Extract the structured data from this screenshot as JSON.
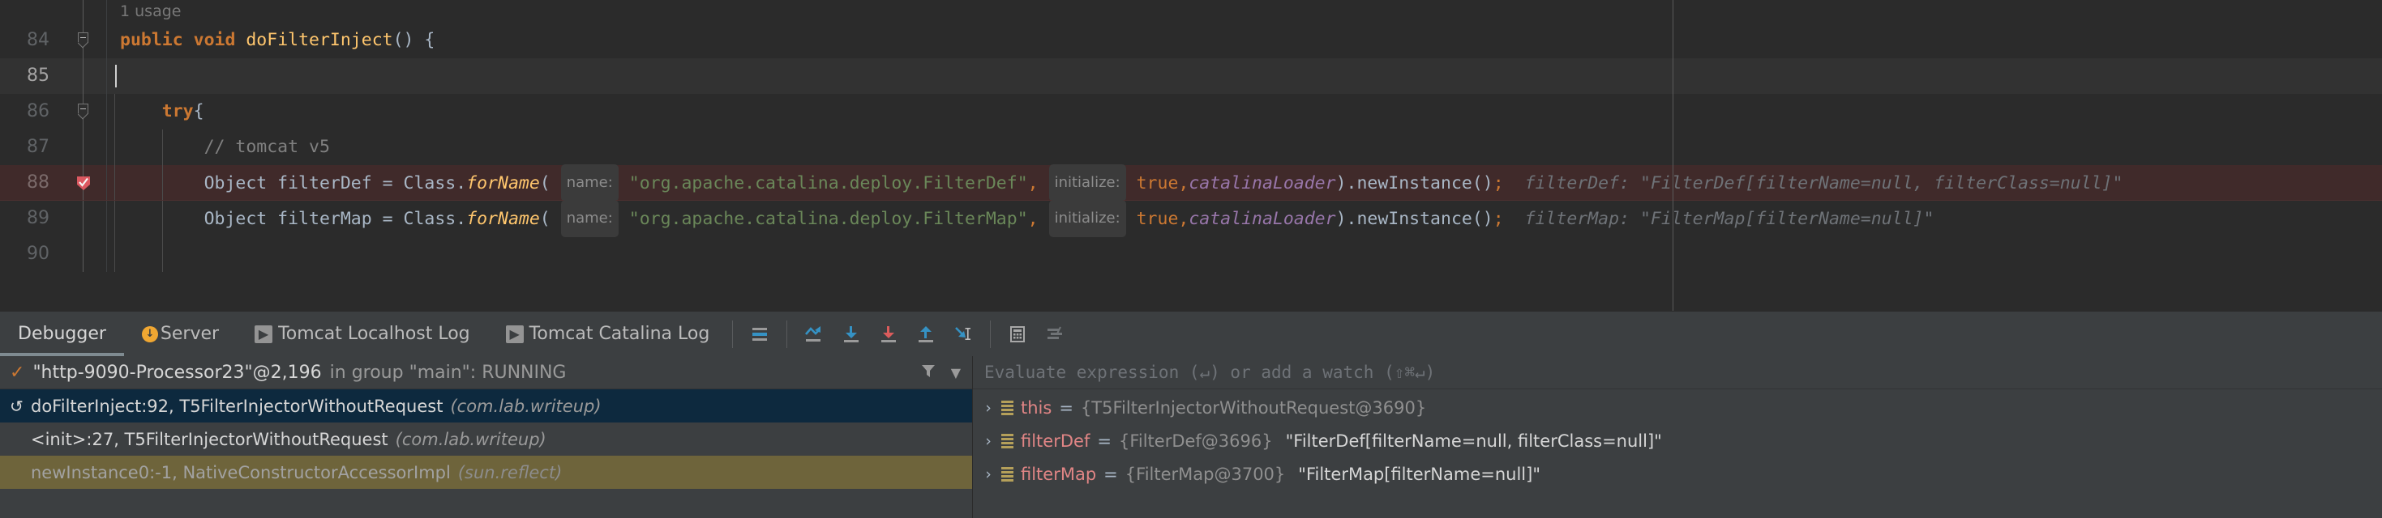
{
  "editor": {
    "usage_hint": "1 usage",
    "margin_line_x": 2063,
    "lines": [
      {
        "num": "84",
        "fold": true,
        "indent": [],
        "html": "<span class=\"kwb\">public</span> <span class=\"kwb\">void</span> <span class=\"mtd\">doFilterInject</span><span class=\"pl\">() {</span>",
        "text": "public void doFilterInject() {"
      },
      {
        "num": "85",
        "fold": false,
        "caret": true,
        "indent": [],
        "html": "",
        "text": ""
      },
      {
        "num": "86",
        "fold": true,
        "indent": [
          141
        ],
        "html": "&nbsp;&nbsp;&nbsp;&nbsp;<span class=\"kwb\">try</span><span class=\"pl\">{</span>",
        "text": "    try{"
      },
      {
        "num": "87",
        "fold": false,
        "indent": [
          141,
          200
        ],
        "html": "&nbsp;&nbsp;&nbsp;&nbsp;&nbsp;&nbsp;&nbsp;&nbsp;<span class=\"cmt\">// tomcat v5</span>",
        "text": "        // tomcat v5"
      },
      {
        "num": "88",
        "breakpoint": true,
        "indent": [
          141,
          200
        ],
        "html": "&nbsp;&nbsp;&nbsp;&nbsp;&nbsp;&nbsp;&nbsp;&nbsp;<span class=\"pl\">Object filterDef = Class.</span><span class=\"mtdi\">forName</span><span class=\"pl\">(</span> <span class=\"hintchip\">name:</span> <span class=\"str\">\"org.apache.catalina.deploy.FilterDef\"</span><span class=\"sem\">,</span> <span class=\"hintchip\">initialize:</span> <span class=\"kw\">true</span><span class=\"sem\">,</span><span class=\"fld\">catalinaLoader</span><span class=\"pl\">).newInstance()</span><span class=\"sem\">;</span>&nbsp;&nbsp;<span class=\"inlay\">filterDef: \"FilterDef[filterName=null, filterClass=null]\"</span>",
        "text": "        Object filterDef = Class.forName( name: \"org.apache.catalina.deploy.FilterDef\", initialize: true,catalinaLoader).newInstance();   filterDef: \"FilterDef[filterName=null, filterClass=null]\""
      },
      {
        "num": "89",
        "indent": [
          141,
          200
        ],
        "html": "&nbsp;&nbsp;&nbsp;&nbsp;&nbsp;&nbsp;&nbsp;&nbsp;<span class=\"pl\">Object filterMap = Class.</span><span class=\"mtdi\">forName</span><span class=\"pl\">(</span> <span class=\"hintchip\">name:</span> <span class=\"str\">\"org.apache.catalina.deploy.FilterMap\"</span><span class=\"sem\">,</span> <span class=\"hintchip\">initialize:</span> <span class=\"kw\">true</span><span class=\"sem\">,</span><span class=\"fld\">catalinaLoader</span><span class=\"pl\">).newInstance()</span><span class=\"sem\">;</span>&nbsp;&nbsp;<span class=\"inlay\">filterMap: \"FilterMap[filterName=null]\"</span>",
        "text": "        Object filterMap = Class.forName( name: \"org.apache.catalina.deploy.FilterMap\", initialize: true,catalinaLoader).newInstance();   filterMap: \"FilterMap[filterName=null]\""
      },
      {
        "num": "90",
        "indent": [
          141,
          200
        ],
        "html": "",
        "text": ""
      }
    ]
  },
  "bottom": {
    "tabs": [
      {
        "label": "Debugger",
        "icon": null,
        "active": true
      },
      {
        "label": "Server",
        "icon": "warning-icon",
        "active": false
      },
      {
        "label": "Tomcat Localhost Log",
        "icon": "run-icon",
        "active": false
      },
      {
        "label": "Tomcat Catalina Log",
        "icon": "run-icon",
        "active": false
      }
    ],
    "toolbar_buttons": [
      {
        "name": "show-execution-point-icon",
        "tooltip": "Show Execution Point"
      },
      {
        "name": "step-over-icon",
        "tooltip": "Step Over"
      },
      {
        "name": "step-into-icon",
        "tooltip": "Step Into"
      },
      {
        "name": "force-step-into-icon",
        "tooltip": "Force Step Into"
      },
      {
        "name": "step-out-icon",
        "tooltip": "Step Out"
      },
      {
        "name": "run-to-cursor-icon",
        "tooltip": "Run to Cursor"
      },
      {
        "name": "evaluate-expression-icon",
        "tooltip": "Evaluate Expression"
      },
      {
        "name": "settings-icon",
        "tooltip": "Layout Settings"
      }
    ],
    "frames_panel": {
      "thread": {
        "status_icon": "check-icon",
        "name": "\"http-9090-Processor23\"@2,196",
        "suffix": "in group \"main\": RUNNING",
        "filter_icon": "filter-icon",
        "dropdown_icon": "chevron-down-icon"
      },
      "frames": [
        {
          "arrow": "↺",
          "title": "doFilterInject:92, T5FilterInjectorWithoutRequest",
          "pkg": "(com.lab.writeup)",
          "state": "selected"
        },
        {
          "arrow": "",
          "title": "<init>:27, T5FilterInjectorWithoutRequest",
          "pkg": "(com.lab.writeup)",
          "state": "normal"
        },
        {
          "arrow": "",
          "title": "newInstance0:-1, NativeConstructorAccessorImpl",
          "pkg": "(sun.reflect)",
          "state": "dimmed"
        }
      ]
    },
    "vars_panel": {
      "eval_placeholder": "Evaluate expression (↵) or add a watch (⇧⌘↵)",
      "variables": [
        {
          "chevron": "›",
          "icon": "field-icon",
          "name": "this",
          "eq": " = ",
          "ref": "{T5FilterInjectorWithoutRequest@3690}",
          "value": ""
        },
        {
          "chevron": "›",
          "icon": "field-icon",
          "name": "filterDef",
          "eq": " = ",
          "ref": "{FilterDef@3696}",
          "value": "\"FilterDef[filterName=null, filterClass=null]\""
        },
        {
          "chevron": "›",
          "icon": "field-icon",
          "name": "filterMap",
          "eq": " = ",
          "ref": "{FilterMap@3700}",
          "value": "\"FilterMap[filterName=null]\""
        }
      ]
    }
  },
  "colors": {
    "editor_bg": "#2b2b2b",
    "panel_bg": "#3c3f41",
    "caret_line": "#323232",
    "breakpoint_line": "#402a2a",
    "selection_blue": "#0d293e",
    "dimmed_frame": "#6e643b",
    "accent_blue": "#3592c4",
    "accent_red": "#db5c5c",
    "string_green": "#6a8759",
    "keyword_orange": "#cc7832"
  }
}
